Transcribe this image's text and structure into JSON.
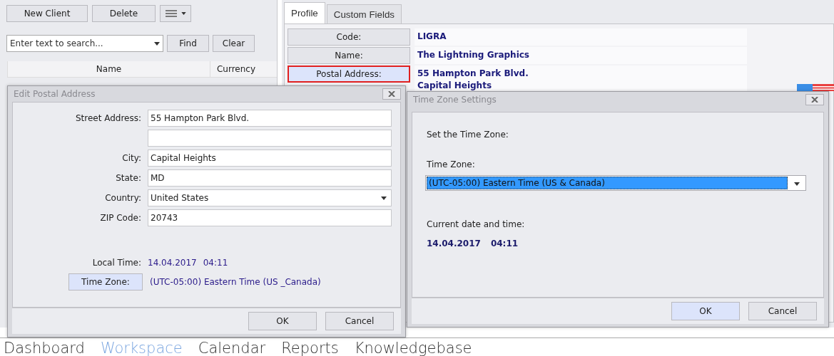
{
  "toolbar": {
    "buttons": [
      "New Client",
      "Delete"
    ]
  },
  "search": {
    "placeholder": "Enter text to search...",
    "buttons": [
      "Find",
      "Clear"
    ]
  },
  "grid": {
    "columns": [
      "Name",
      "Currency"
    ]
  },
  "tabs": [
    {
      "label": "Profile",
      "selected": true
    },
    {
      "label": "Custom Fields",
      "selected": false
    }
  ],
  "profile": [
    {
      "label": "Code:",
      "value": "LIGRA",
      "selected": false
    },
    {
      "label": "Name:",
      "value": "The Lightning Graphics",
      "selected": false
    },
    {
      "label": "Postal Address:",
      "lines": [
        "55 Hampton Park Blvd.",
        "Capital Heights"
      ],
      "selected": true
    }
  ],
  "bottom_nav": [
    {
      "label": "Dashboard",
      "selected": false
    },
    {
      "label": "Workspace",
      "selected": true
    },
    {
      "label": "Calendar",
      "selected": false
    },
    {
      "label": "Reports",
      "selected": false
    },
    {
      "label": "Knowledgebase",
      "selected": false
    }
  ],
  "edit_dialog": {
    "title": "Edit Postal Address",
    "fields": [
      {
        "kind": "text",
        "label": "Street Address:",
        "value": "55 Hampton Park Blvd."
      },
      {
        "kind": "text"
      },
      {
        "kind": "text",
        "label": "City:",
        "value": "Capital Heights"
      },
      {
        "kind": "text",
        "label": "State:",
        "value": "MD"
      },
      {
        "kind": "select",
        "label": "Country:",
        "value": "United States"
      },
      {
        "kind": "text",
        "label": "ZIP Code:",
        "value": "20743"
      }
    ],
    "local_time": {
      "label": "Local Time:",
      "date": "14.04.2017",
      "time": "04:11"
    },
    "time_zone": {
      "button": "Time Zone:",
      "value": "(UTC-05:00) Eastern Time (US _Canada)"
    },
    "buttons": [
      {
        "label": "OK",
        "default": false
      },
      {
        "label": "Cancel",
        "default": false
      }
    ]
  },
  "tz_dialog": {
    "title": "Time Zone Settings",
    "prompt": "Set the Time Zone:",
    "zone_label": "Time Zone:",
    "zone_value": "(UTC-05:00) Eastern Time (US & Canada)",
    "current_label": "Current date and time:",
    "date": "14.04.2017",
    "time": "04:11",
    "buttons": [
      {
        "label": "OK",
        "default": true
      },
      {
        "label": "Cancel",
        "default": false
      }
    ]
  }
}
